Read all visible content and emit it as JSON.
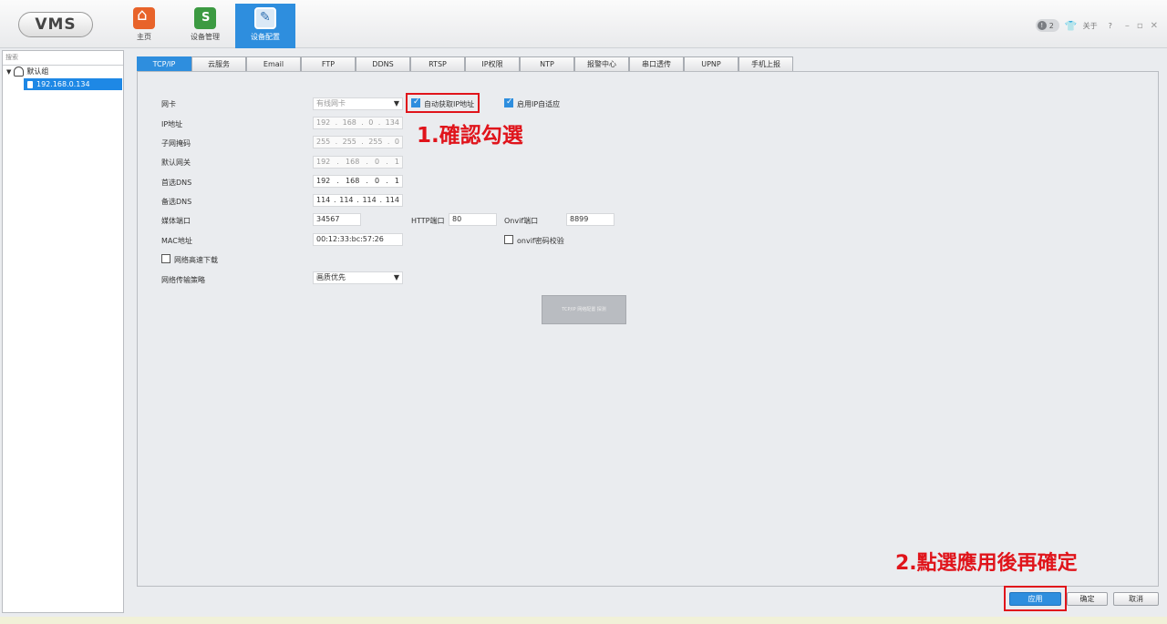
{
  "header": {
    "logo": "VMS",
    "nav": [
      {
        "label": "主页",
        "icon": "home-icon"
      },
      {
        "label": "设备管理",
        "icon": "device-manager-icon"
      },
      {
        "label": "设备配置",
        "icon": "device-config-icon"
      }
    ],
    "badge_count": "2",
    "about_label": "关于",
    "help_label": "?",
    "window_controls": [
      "–",
      "▫",
      "✕"
    ]
  },
  "sidebar": {
    "search_placeholder": "搜索",
    "group_label": "默认组",
    "device": "192.168.0.134"
  },
  "tabs": [
    "TCP/IP",
    "云服务",
    "Email",
    "FTP",
    "DDNS",
    "RTSP",
    "IP权限",
    "NTP",
    "报警中心",
    "串口透传",
    "UPNP",
    "手机上报"
  ],
  "form": {
    "nic_label": "网卡",
    "nic_value": "有线网卡",
    "auto_ip_label": "自动获取IP地址",
    "auto_ip_checked": true,
    "adaptive_label": "启用IP自适应",
    "adaptive_checked": true,
    "ip_label": "IP地址",
    "ip": [
      "192",
      "168",
      "0",
      "134"
    ],
    "mask_label": "子网掩码",
    "mask": [
      "255",
      "255",
      "255",
      "0"
    ],
    "gateway_label": "默认网关",
    "gateway": [
      "192",
      "168",
      "0",
      "1"
    ],
    "dns1_label": "首选DNS",
    "dns1": [
      "192",
      "168",
      "0",
      "1"
    ],
    "dns2_label": "备选DNS",
    "dns2": [
      "114",
      "114",
      "114",
      "114"
    ],
    "media_port_label": "媒体端口",
    "media_port": "34567",
    "http_port_label": "HTTP端口",
    "http_port": "80",
    "onvif_port_label": "Onvif端口",
    "onvif_port": "8899",
    "mac_label": "MAC地址",
    "mac": "00:12:33:bc:57:26",
    "onvif_auth_label": "onvif密码校验",
    "onvif_auth_checked": false,
    "fast_download_label": "网络高速下载",
    "fast_download_checked": false,
    "strategy_label": "网络传输策略",
    "strategy_value": "画质优先",
    "probe_button": "TCP/IP 网络配置 探测"
  },
  "annotations": {
    "step1": "1.確認勾選",
    "step2": "2.點選應用後再確定"
  },
  "footer": {
    "apply": "应用",
    "ok": "确定",
    "cancel": "取消"
  },
  "colors": {
    "accent": "#2e8ede",
    "annotation_red": "#e0141b"
  }
}
